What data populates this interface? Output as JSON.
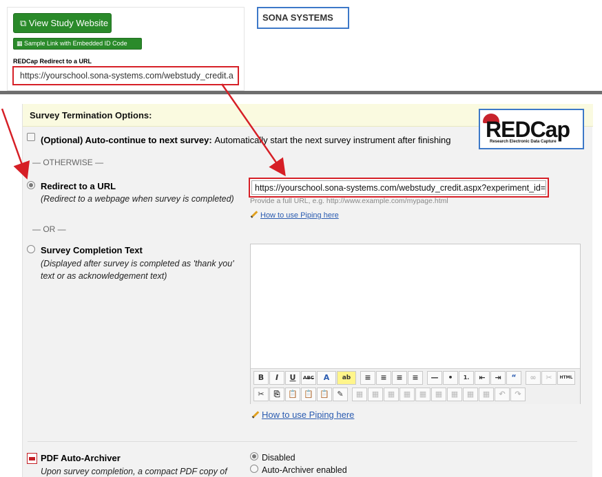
{
  "sona": {
    "view_study_button": "View Study Website",
    "sample_link_button": "Sample Link with Embedded ID Code",
    "redcap_redirect_label": "REDCap Redirect to a URL",
    "redirect_url": "https://yourschool.sona-systems.com/webstudy_credit.a",
    "logo_text": "SONA SYSTEMS"
  },
  "redcap_logo": {
    "word": "REDCap",
    "tagline": "Research Electronic Data Capture"
  },
  "survey_termination": {
    "header": "Survey Termination Options:",
    "auto_continue": {
      "label": "(Optional) Auto-continue to next survey:",
      "description": "Automatically start the next survey instrument after finishing"
    },
    "otherwise_separator": "— OTHERWISE —",
    "redirect": {
      "label": "Redirect to a URL",
      "description": "(Redirect to a webpage when survey is completed)",
      "url_value": "https://yourschool.sona-systems.com/webstudy_credit.aspx?experiment_id=",
      "hint": "Provide a full URL, e.g. http://www.example.com/mypage.html",
      "piping_link": "How to use Piping here"
    },
    "or_separator": "— OR —",
    "completion_text": {
      "label": "Survey Completion Text",
      "description": "(Displayed after survey is completed as 'thank you' text or as acknowledgement text)",
      "piping_link": "How to use Piping here"
    },
    "pdf_archiver": {
      "label": "PDF Auto-Archiver",
      "description": "Upon survey completion, a compact PDF copy of",
      "options": [
        "Disabled",
        "Auto-Archiver enabled"
      ],
      "selected": "Disabled"
    }
  },
  "editor_toolbar": {
    "row1": [
      "B",
      "I",
      "U",
      "ABC",
      "A",
      "ab",
      "≡",
      "≡",
      "≡",
      "≡",
      "—",
      "•",
      "1.",
      "⇤",
      "⇥",
      "“",
      "∞",
      "✂",
      "HTML"
    ],
    "row2": [
      "✂",
      "⎘",
      "📋",
      "📋",
      "📋",
      "✎",
      "▦",
      "▦",
      "▦",
      "▦",
      "▦",
      "▦",
      "▦",
      "▦",
      "▦",
      "↶",
      "↷"
    ]
  },
  "colors": {
    "highlight_red": "#d61f26",
    "button_green": "#2a8a2a",
    "header_bg": "#fafae0",
    "panel_bg": "#f2f2f2",
    "link_blue": "#2a5bb0"
  }
}
